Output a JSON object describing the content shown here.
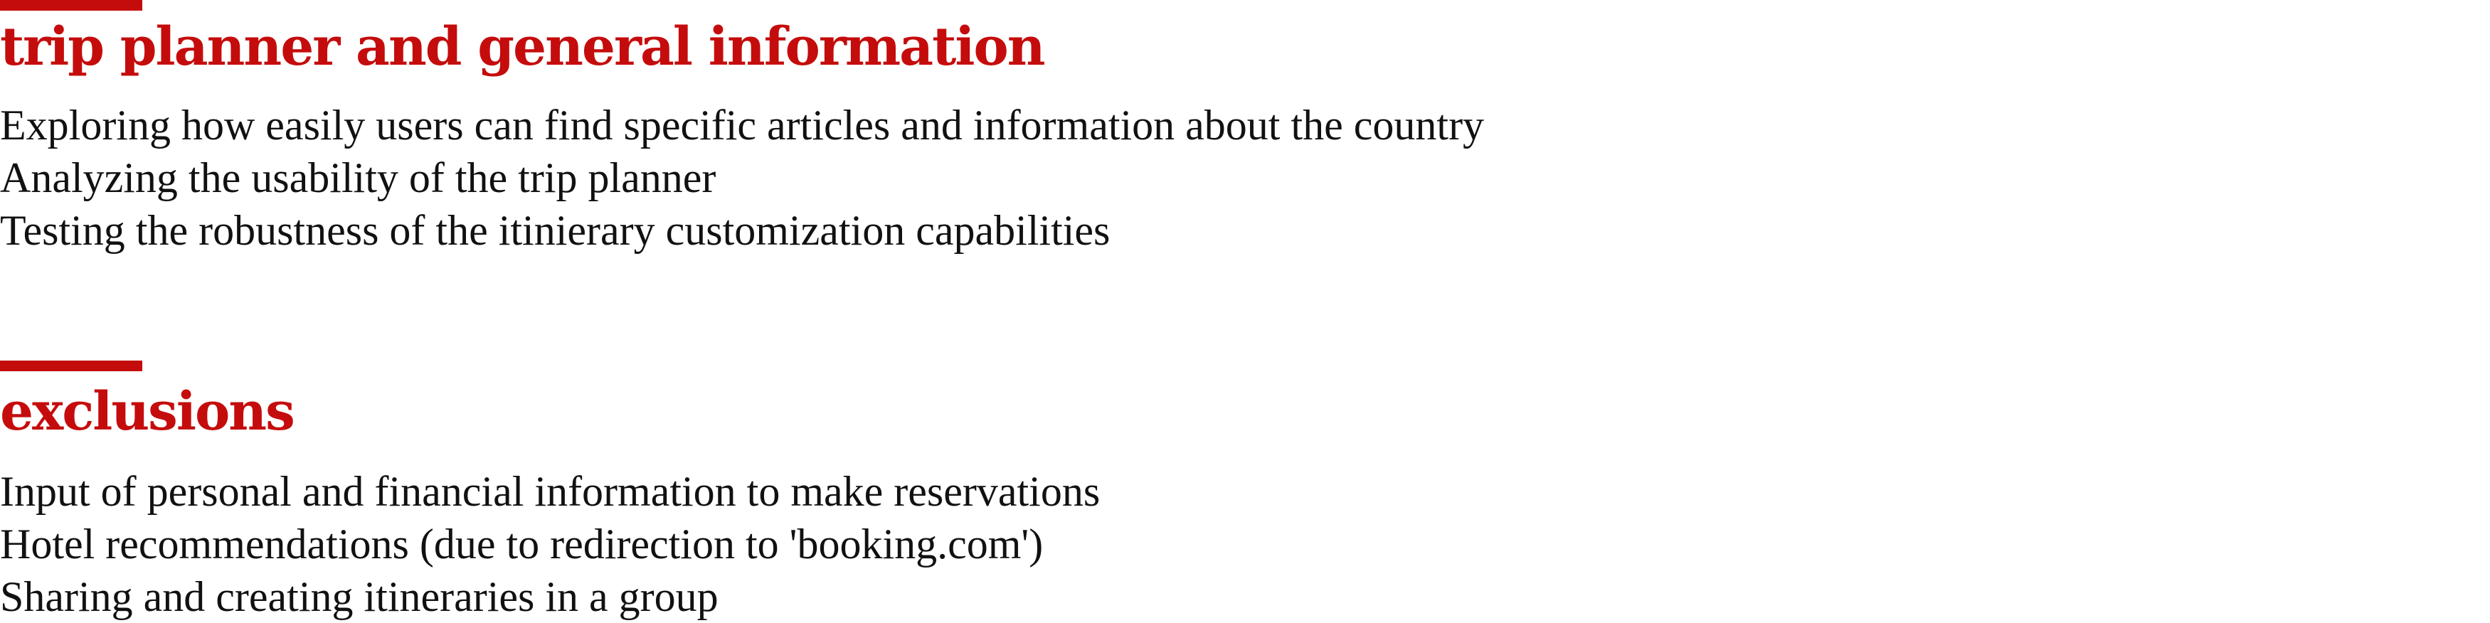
{
  "sections": [
    {
      "title": "trip planner and general information",
      "items": [
        "Exploring how easily users can find specific articles and information about the country",
        "Analyzing the usability of the trip planner",
        "Testing the robustness of the itinierary customization capabilities"
      ]
    },
    {
      "title": "exclusions",
      "items": [
        "Input of personal and financial information to make reservations",
        "Hotel recommendations (due to redirection to 'booking.com')",
        "Sharing and creating itineraries in a group"
      ]
    }
  ],
  "colors": {
    "accent": "#c50c0c",
    "text": "#111111",
    "background": "#ffffff"
  }
}
